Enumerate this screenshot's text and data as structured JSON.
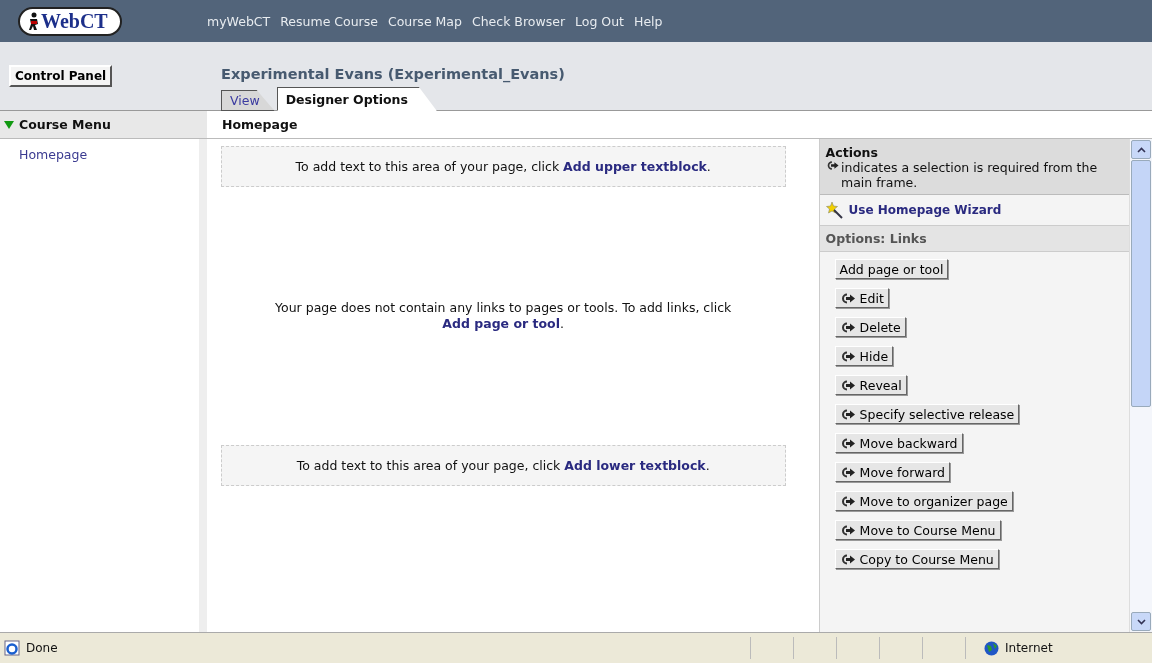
{
  "logo": {
    "text": "WebCT"
  },
  "nav": [
    "myWebCT",
    "Resume Course",
    "Course Map",
    "Check Browser",
    "Log Out",
    "Help"
  ],
  "control_panel": "Control Panel",
  "course_title": "Experimental Evans  (Experimental_Evans)",
  "tabs": [
    {
      "label": "View",
      "selected": false
    },
    {
      "label": "Designer Options",
      "selected": true
    }
  ],
  "course_menu": {
    "title": "Course Menu",
    "expanded": true,
    "items": [
      "Homepage"
    ]
  },
  "page_title": "Homepage",
  "upper_block": {
    "prefix": "To add text to this area of your page, click ",
    "link": "Add upper textblock",
    "suffix": "."
  },
  "empty_message": {
    "prefix": "Your page does not contain any links to pages or tools. To add links, click ",
    "link": "Add page or tool",
    "suffix": "."
  },
  "lower_block": {
    "prefix": "To add text to this area of your page, click ",
    "link": "Add lower textblock",
    "suffix": "."
  },
  "actions": {
    "title": "Actions",
    "note": "indicates a selection is required from the main frame.",
    "wizard": "Use Homepage Wizard",
    "options_title": "Options: Links",
    "buttons": [
      {
        "label": "Add page or tool",
        "kind": "plain"
      },
      {
        "label": "Edit",
        "kind": "selection"
      },
      {
        "label": "Delete",
        "kind": "selection"
      },
      {
        "label": "Hide",
        "kind": "selection"
      },
      {
        "label": "Reveal",
        "kind": "selection"
      },
      {
        "label": "Specify selective release",
        "kind": "selection"
      },
      {
        "label": "Move backward",
        "kind": "selection"
      },
      {
        "label": "Move forward",
        "kind": "selection"
      },
      {
        "label": "Move to organizer page",
        "kind": "selection"
      },
      {
        "label": "Move to Course Menu",
        "kind": "selection"
      },
      {
        "label": "Copy to Course Menu",
        "kind": "selection"
      }
    ]
  },
  "status_bar": {
    "status": "Done",
    "zone": "Internet"
  }
}
